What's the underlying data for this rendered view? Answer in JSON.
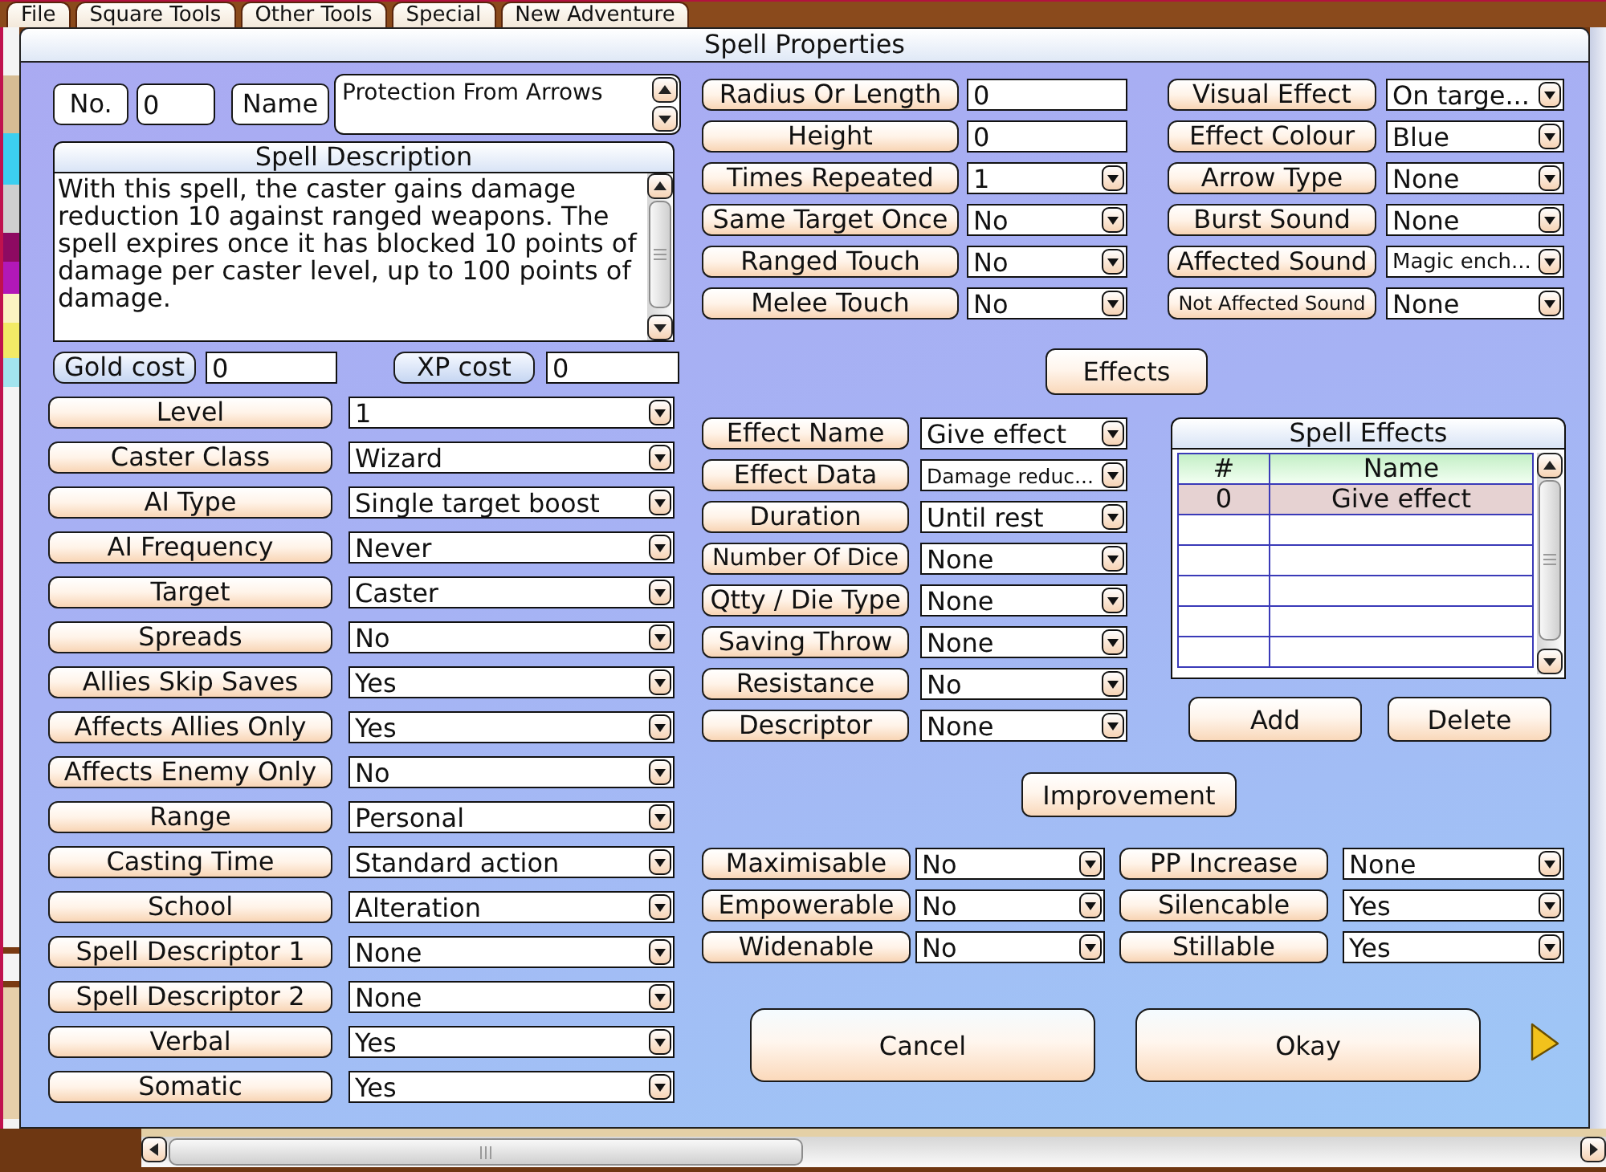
{
  "menu_tabs": [
    "File",
    "Square Tools",
    "Other Tools",
    "Special",
    "New Adventure"
  ],
  "dialog": {
    "title": "Spell Properties",
    "number": {
      "label": "No.",
      "value": "0"
    },
    "name": {
      "label": "Name",
      "value": "Protection From Arrows"
    },
    "description": {
      "title": "Spell Description",
      "text": "With this spell, the caster gains damage reduction 10 against ranged weapons. The spell expires once it has blocked 10 points of damage per caster level, up to 100 points of damage."
    },
    "costs": [
      {
        "label": "Gold cost",
        "value": "0"
      },
      {
        "label": "XP cost",
        "value": "0"
      }
    ],
    "properties": [
      {
        "label": "Level",
        "value": "1"
      },
      {
        "label": "Caster Class",
        "value": "Wizard"
      },
      {
        "label": "AI Type",
        "value": "Single target boost"
      },
      {
        "label": "AI Frequency",
        "value": "Never"
      },
      {
        "label": "Target",
        "value": "Caster"
      },
      {
        "label": "Spreads",
        "value": "No"
      },
      {
        "label": "Allies Skip Saves",
        "value": "Yes"
      },
      {
        "label": "Affects Allies Only",
        "value": "Yes"
      },
      {
        "label": "Affects Enemy Only",
        "value": "No"
      },
      {
        "label": "Range",
        "value": "Personal"
      },
      {
        "label": "Casting Time",
        "value": "Standard action"
      },
      {
        "label": "School",
        "value": "Alteration"
      },
      {
        "label": "Spell Descriptor 1",
        "value": "None"
      },
      {
        "label": "Spell Descriptor 2",
        "value": "None"
      },
      {
        "label": "Verbal",
        "value": "Yes"
      },
      {
        "label": "Somatic",
        "value": "Yes"
      }
    ],
    "area_properties": [
      {
        "label": "Radius Or Length",
        "value": "0",
        "kind": "text"
      },
      {
        "label": "Height",
        "value": "0",
        "kind": "text"
      },
      {
        "label": "Times Repeated",
        "value": "1",
        "kind": "dropdown"
      },
      {
        "label": "Same Target Once",
        "value": "No",
        "kind": "dropdown"
      },
      {
        "label": "Ranged Touch",
        "value": "No",
        "kind": "dropdown"
      },
      {
        "label": "Melee Touch",
        "value": "No",
        "kind": "dropdown"
      }
    ],
    "visual_properties": [
      {
        "label": "Visual Effect",
        "value": "On targe..."
      },
      {
        "label": "Effect Colour",
        "value": "Blue"
      },
      {
        "label": "Arrow Type",
        "value": "None"
      },
      {
        "label": "Burst Sound",
        "value": "None"
      },
      {
        "label": "Affected Sound",
        "value": "Magic ench..."
      },
      {
        "label": "Not Affected Sound",
        "value": "None"
      }
    ],
    "effects_button": "Effects",
    "effect_properties": [
      {
        "label": "Effect Name",
        "value": "Give effect"
      },
      {
        "label": "Effect Data",
        "value": "Damage reduc..."
      },
      {
        "label": "Duration",
        "value": "Until rest"
      },
      {
        "label": "Number Of Dice",
        "value": "None"
      },
      {
        "label": "Qtty / Die Type",
        "value": "None"
      },
      {
        "label": "Saving Throw",
        "value": "None"
      },
      {
        "label": "Resistance",
        "value": "No"
      },
      {
        "label": "Descriptor",
        "value": "None"
      }
    ],
    "spell_effects": {
      "title": "Spell Effects",
      "columns": [
        "#",
        "Name"
      ],
      "rows": [
        {
          "cells": [
            "0",
            "Give effect"
          ],
          "selected": true
        }
      ]
    },
    "effect_buttons": [
      "Add",
      "Delete"
    ],
    "improvement_button": "Improvement",
    "metamagic": [
      {
        "label": "Maximisable",
        "value": "No"
      },
      {
        "label": "PP Increase",
        "value": "None"
      },
      {
        "label": "Empowerable",
        "value": "No"
      },
      {
        "label": "Silencable",
        "value": "Yes"
      },
      {
        "label": "Widenable",
        "value": "No"
      },
      {
        "label": "Stillable",
        "value": "Yes"
      }
    ],
    "buttons": [
      "Cancel",
      "Okay"
    ]
  }
}
